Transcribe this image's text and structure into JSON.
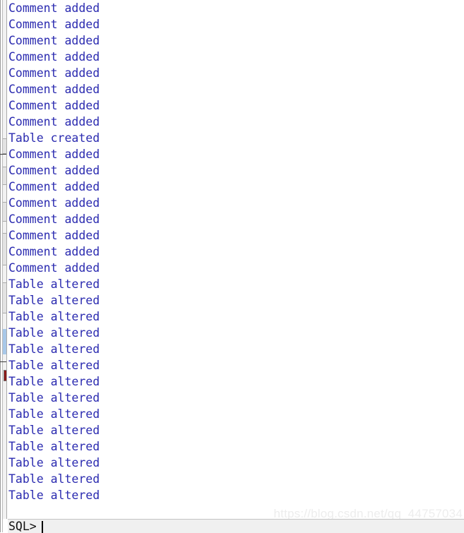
{
  "window": {
    "kind": "sql-console",
    "background_color": "#ffffff",
    "text_color": "#2b2bb0"
  },
  "console": {
    "lines": [
      "Comment added",
      "Comment added",
      "Comment added",
      "Comment added",
      "Comment added",
      "Comment added",
      "Comment added",
      "Comment added",
      "Table created",
      "Comment added",
      "Comment added",
      "Comment added",
      "Comment added",
      "Comment added",
      "Comment added",
      "Comment added",
      "Comment added",
      "Table altered",
      "Table altered",
      "Table altered",
      "Table altered",
      "Table altered",
      "Table altered",
      "Table altered",
      "Table altered",
      "Table altered",
      "Table altered",
      "Table altered",
      "Table altered",
      "Table altered",
      "Table altered"
    ]
  },
  "prompt": {
    "label": "SQL>",
    "value": "",
    "placeholder": ""
  },
  "watermark": {
    "text": "https://blog.csdn.net/qq_44757034"
  }
}
